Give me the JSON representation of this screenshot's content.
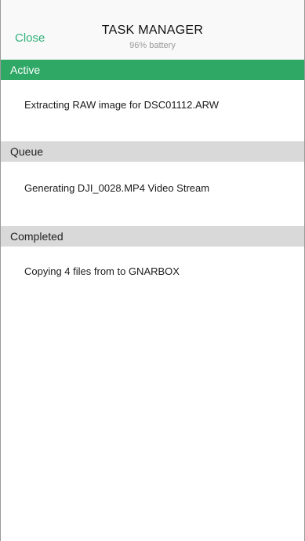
{
  "header": {
    "close_label": "Close",
    "title": "TASK MANAGER",
    "battery": "96% battery"
  },
  "sections": {
    "active": {
      "label": "Active",
      "task": "Extracting RAW image for DSC01112.ARW"
    },
    "queue": {
      "label": "Queue",
      "task": "Generating DJI_0028.MP4 Video Stream"
    },
    "completed": {
      "label": "Completed",
      "task": "Copying 4 files from  to GNARBOX"
    }
  },
  "colors": {
    "accent": "#2fa866",
    "close_text": "#2fb17a",
    "section_gray": "#d9d9d9"
  }
}
